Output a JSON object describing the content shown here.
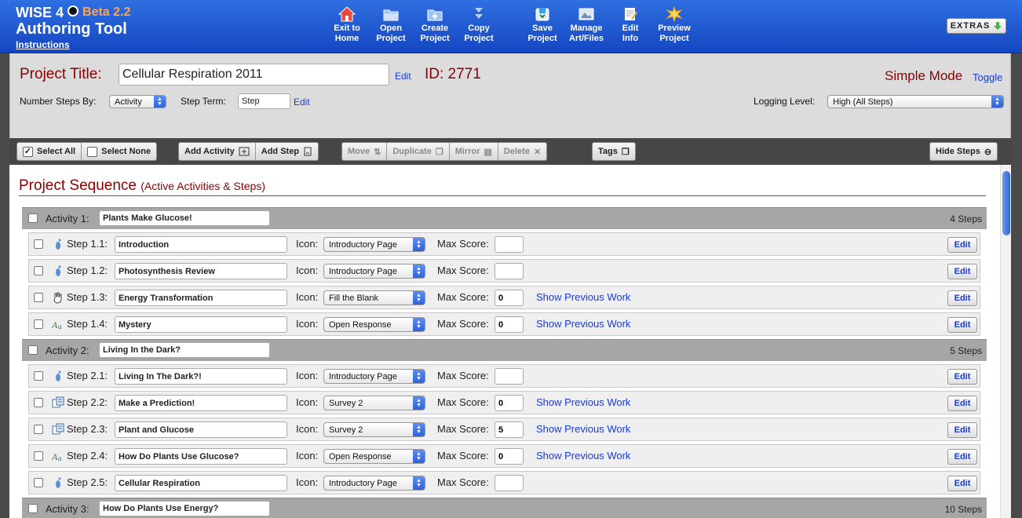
{
  "brand": {
    "line1": "WISE 4",
    "beta": "Beta 2.2",
    "line2": "Authoring Tool",
    "instructions": "Instructions"
  },
  "nav": [
    {
      "line1": "Exit to",
      "line2": "Home",
      "icon": "home-icon"
    },
    {
      "line1": "Open",
      "line2": "Project",
      "icon": "folder-open-icon"
    },
    {
      "line1": "Create",
      "line2": "Project",
      "icon": "folder-plus-icon"
    },
    {
      "line1": "Copy",
      "line2": "Project",
      "icon": "copy-arrow-icon"
    },
    {
      "line1": "Save",
      "line2": "Project",
      "icon": "save-icon"
    },
    {
      "line1": "Manage",
      "line2": "Art/Files",
      "icon": "image-icon"
    },
    {
      "line1": "Edit",
      "line2": "Info",
      "icon": "pencil-icon"
    },
    {
      "line1": "Preview",
      "line2": "Project",
      "icon": "starburst-icon"
    }
  ],
  "extras": "EXTRAS",
  "project": {
    "title_label": "Project Title:",
    "title_value": "Cellular Respiration 2011",
    "edit": "Edit",
    "id_label": "ID: 2771",
    "mode": "Simple Mode",
    "toggle": "Toggle",
    "number_steps_label": "Number Steps By:",
    "number_steps_value": "Activity",
    "step_term_label": "Step Term:",
    "step_term_value": "Step",
    "logging_label": "Logging Level:",
    "logging_value": "High (All Steps)"
  },
  "toolbar": {
    "select_all": "Select All",
    "select_none": "Select None",
    "add_activity": "Add Activity",
    "add_step": "Add Step",
    "move": "Move",
    "duplicate": "Duplicate",
    "mirror": "Mirror",
    "delete": "Delete",
    "tags": "Tags",
    "hide_steps": "Hide Steps"
  },
  "sequence": {
    "title": "Project Sequence",
    "subtitle": "(Active Activities & Steps)"
  },
  "labels": {
    "icon": "Icon:",
    "max_score": "Max Score:",
    "show_previous": "Show Previous Work",
    "edit": "Edit"
  },
  "activities": [
    {
      "label": "Activity 1:",
      "name": "Plants Make Glucose!",
      "count": "4 Steps"
    },
    {
      "label": "Activity 2:",
      "name": "Living In the Dark?",
      "count": "5 Steps"
    },
    {
      "label": "Activity 3:",
      "name": "How Do Plants Use Energy?",
      "count": "10 Steps"
    }
  ],
  "steps": [
    {
      "label": "Step 1.1:",
      "name": "Introduction",
      "icon_type": "Introductory Page",
      "icon": "footprint-icon",
      "score": "",
      "show_prev": false
    },
    {
      "label": "Step 1.2:",
      "name": "Photosynthesis Review",
      "icon_type": "Introductory Page",
      "icon": "footprint-icon",
      "score": "",
      "show_prev": false
    },
    {
      "label": "Step 1.3:",
      "name": "Energy Transformation",
      "icon_type": "Fill the Blank",
      "icon": "hand-icon",
      "score": "0",
      "show_prev": true
    },
    {
      "label": "Step 1.4:",
      "name": "Mystery",
      "icon_type": "Open Response",
      "icon": "text-response-icon",
      "score": "0",
      "show_prev": true
    },
    {
      "label": "Step 2.1:",
      "name": "Living In The Dark?!",
      "icon_type": "Introductory Page",
      "icon": "footprint-icon",
      "score": "",
      "show_prev": false
    },
    {
      "label": "Step 2.2:",
      "name": "Make a Prediction!",
      "icon_type": "Survey 2",
      "icon": "survey-icon",
      "score": "0",
      "show_prev": true
    },
    {
      "label": "Step 2.3:",
      "name": "Plant and Glucose",
      "icon_type": "Survey 2",
      "icon": "survey-icon",
      "score": "5",
      "show_prev": true
    },
    {
      "label": "Step 2.4:",
      "name": "How Do Plants Use Glucose?",
      "icon_type": "Open Response",
      "icon": "text-response-icon",
      "score": "0",
      "show_prev": true
    },
    {
      "label": "Step 2.5:",
      "name": "Cellular Respiration",
      "icon_type": "Introductory Page",
      "icon": "footprint-icon",
      "score": "",
      "show_prev": false
    }
  ]
}
